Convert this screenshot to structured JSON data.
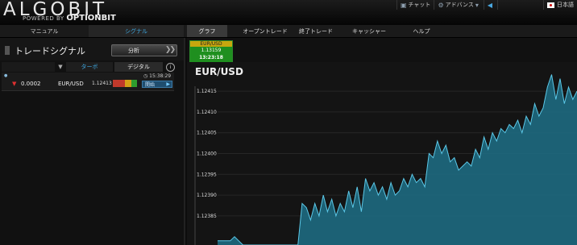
{
  "app": {
    "logo_text": "ALGOBIT",
    "powered_by": "POWERED BY",
    "powered_brand": "OPTIONBIT"
  },
  "top_menu": {
    "chat_label": "チャット",
    "advance_label": "アドバンス",
    "language_label": "日本語"
  },
  "left_nav": {
    "manual_label": "マニュアル",
    "signal_label": "シグナル"
  },
  "main_nav": {
    "tabs": [
      "グラフ",
      "オープントレード",
      "終了トレード",
      "キャッシャー",
      "ヘルプ"
    ],
    "active": "グラフ"
  },
  "signal_panel": {
    "title": "トレードシグナル",
    "analysis_button": "分析",
    "tab_turbo": "ターボ",
    "tab_digital": "デジタル",
    "info_glyph": "i",
    "row": {
      "direction": "down",
      "value": "0.0002",
      "pair": "EUR/USD",
      "rate": "1.12413",
      "time": "15:38:29",
      "start_label": "開始",
      "strength_colors": [
        "#c0392b",
        "#c0392b",
        "#d4a017",
        "#2e9e2e"
      ]
    }
  },
  "quote_box": {
    "pair": "EUR/USD",
    "rate": "1.13159",
    "time": "13:23:18"
  },
  "chart_data": {
    "type": "area",
    "title": "EUR/USD",
    "ylim": [
      1.12378,
      1.12422
    ],
    "yticks": [
      "1.12385",
      "1.12390",
      "1.12395",
      "1.12400",
      "1.12405",
      "1.12410",
      "1.12415"
    ],
    "series": [
      {
        "values": [
          1.12379,
          1.12379,
          1.12379,
          1.12379,
          1.1238,
          1.12379,
          1.12378,
          1.12378,
          1.12378,
          1.12378,
          1.12378,
          1.12378,
          1.12378,
          1.12378,
          1.12378,
          1.12378,
          1.12378,
          1.12378,
          1.12378,
          1.12378,
          1.12388,
          1.12387,
          1.12384,
          1.12388,
          1.12385,
          1.1239,
          1.12386,
          1.12389,
          1.12385,
          1.12388,
          1.12386,
          1.12391,
          1.12387,
          1.12392,
          1.12386,
          1.12394,
          1.12391,
          1.12393,
          1.1239,
          1.12392,
          1.12389,
          1.12393,
          1.1239,
          1.12391,
          1.12394,
          1.12392,
          1.12395,
          1.12393,
          1.12394,
          1.12392,
          1.124,
          1.12399,
          1.12403,
          1.124,
          1.12402,
          1.12398,
          1.12399,
          1.12396,
          1.12397,
          1.12398,
          1.12397,
          1.12401,
          1.12399,
          1.12404,
          1.12401,
          1.12405,
          1.12403,
          1.12406,
          1.12405,
          1.12407,
          1.12406,
          1.12408,
          1.12405,
          1.12409,
          1.12407,
          1.12412,
          1.12409,
          1.12411,
          1.12416,
          1.12419,
          1.12413,
          1.12418,
          1.12412,
          1.12416,
          1.12413,
          1.12415
        ]
      }
    ],
    "line_color": "#5bc8e8",
    "fill_color": "#1d6f86"
  }
}
